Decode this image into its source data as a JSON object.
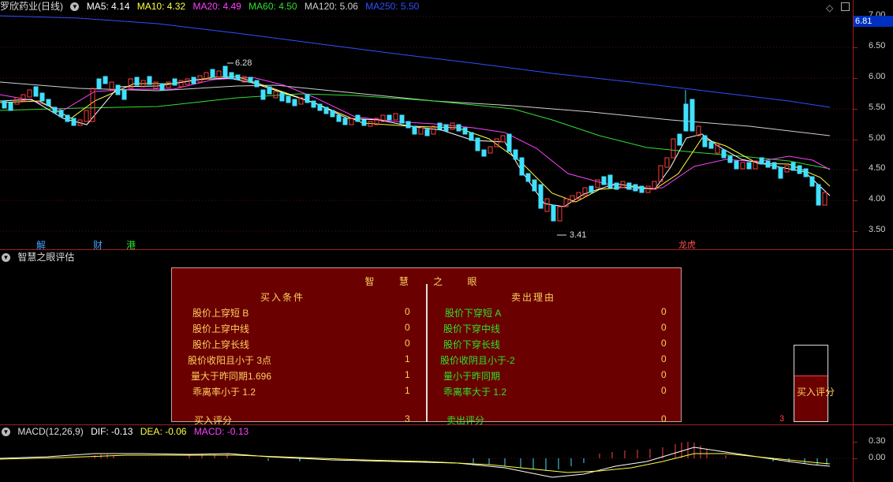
{
  "kline_header": {
    "title": "罗欣药业(日线)",
    "ma5": "MA5: 4.14",
    "ma10": "MA10: 4.32",
    "ma20": "MA20: 4.49",
    "ma60": "MA60: 4.50",
    "ma120": "MA120: 5.06",
    "ma250": "MA250: 5.50"
  },
  "price_axis": [
    "7.00",
    "6.50",
    "6.00",
    "5.50",
    "5.00",
    "4.50",
    "4.00",
    "3.50"
  ],
  "current_price": "6.81",
  "high_label": "6.28",
  "low_label": "3.41",
  "markers": [
    {
      "text": "解",
      "color": "#40a0ff"
    },
    {
      "text": "财",
      "color": "#40a0ff"
    },
    {
      "text": "港",
      "color": "#30e030"
    },
    {
      "text": "龙虎",
      "color": "#ff5050"
    }
  ],
  "indicator_header": {
    "title": "智慧之眼评估"
  },
  "panel": {
    "title": "智 慧 之 眼",
    "buy_header": "买入条件",
    "sell_header": "卖出理由",
    "buy_rows": [
      {
        "label": "股价上穿短 B",
        "value": "0"
      },
      {
        "label": "股价上穿中线",
        "value": "0"
      },
      {
        "label": "股价上穿长线",
        "value": "0"
      },
      {
        "label": "股价收阳且小于 3点",
        "value": "1"
      },
      {
        "label": "量大于昨同期1.696",
        "value": "1"
      },
      {
        "label": "乖离率小于 1.2",
        "value": "1"
      }
    ],
    "sell_rows": [
      {
        "label": "股价下穿短 A",
        "value": "0"
      },
      {
        "label": "股价下穿中线",
        "value": "0"
      },
      {
        "label": "股价下穿长线",
        "value": "0"
      },
      {
        "label": "股价收阴且小于-2",
        "value": "0"
      },
      {
        "label": "量小于昨同期",
        "value": "0"
      },
      {
        "label": "乖离率大于 1.2",
        "value": "0"
      }
    ],
    "buy_score_label": "买入评分",
    "buy_score_value": "3",
    "sell_score_label": "卖出评分",
    "sell_score_value": "0"
  },
  "score_bar": {
    "label": "买入评分",
    "value": "3",
    "fill_fraction": 0.6
  },
  "macd_header": {
    "title": "MACD(12,26,9)",
    "dif": "DIF: -0.13",
    "dea": "DEA: -0.06",
    "macd": "MACD: -0.13"
  },
  "macd_axis": [
    "0.30",
    "0.00"
  ],
  "colors": {
    "ma5": "#ffffff",
    "ma10": "#ffff40",
    "ma20": "#ff40ff",
    "ma60": "#30e030",
    "ma120": "#d0d0d0",
    "ma250": "#3050ff",
    "up": "#ff4040",
    "down": "#40e0ff",
    "grid": "#a02020",
    "panel_bg": "#6b0000"
  }
}
